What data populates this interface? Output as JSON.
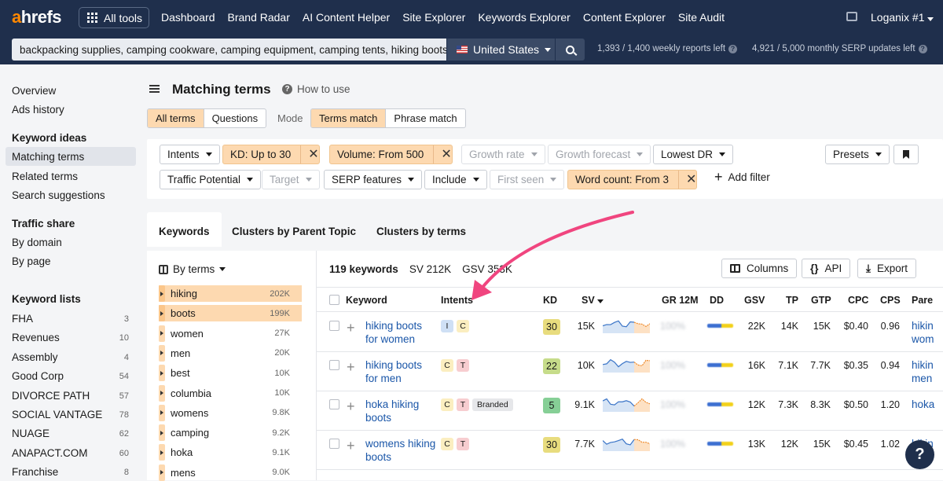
{
  "topbar": {
    "logo_a": "a",
    "logo_rest": "hrefs",
    "all_tools": "All tools",
    "nav": [
      "Dashboard",
      "Brand Radar",
      "AI Content Helper",
      "Site Explorer",
      "Keywords Explorer",
      "Content Explorer",
      "Site Audit"
    ],
    "active_nav": "Keywords Explorer",
    "user": "Loganix #1"
  },
  "searchbar": {
    "keywords": "backpacking supplies, camping cookware, camping equipment, camping tents, hiking boots, h",
    "country": "United States",
    "weekly_reports": "1,393  /  1,400  weekly reports left",
    "serp_updates": "4,921  /  5,000  monthly SERP updates left"
  },
  "sidebar": {
    "top_items": [
      "Overview",
      "Ads history"
    ],
    "keyword_ideas_head": "Keyword ideas",
    "keyword_ideas": [
      "Matching terms",
      "Related terms",
      "Search suggestions"
    ],
    "active": "Matching terms",
    "traffic_share_head": "Traffic share",
    "traffic_share": [
      "By domain",
      "By page"
    ],
    "keyword_lists_head": "Keyword lists",
    "keyword_lists": [
      {
        "name": "FHA",
        "count": "3"
      },
      {
        "name": "Revenues",
        "count": "10"
      },
      {
        "name": "Assembly",
        "count": "4"
      },
      {
        "name": "Good Corp",
        "count": "54"
      },
      {
        "name": "DIVORCE PATH",
        "count": "57"
      },
      {
        "name": "SOCIAL VANTAGE",
        "count": "78"
      },
      {
        "name": "NUAGE",
        "count": "62"
      },
      {
        "name": "ANAPACT.COM",
        "count": "60"
      },
      {
        "name": "Franchise",
        "count": "8"
      }
    ]
  },
  "page": {
    "title": "Matching terms",
    "how_to": "How to use",
    "seg1": [
      "All terms",
      "Questions"
    ],
    "mode_label": "Mode",
    "seg2": [
      "Terms match",
      "Phrase match"
    ]
  },
  "filters": {
    "intents": "Intents",
    "kd": "KD: Up to 30",
    "volume": "Volume: From 500",
    "growth_rate": "Growth rate",
    "growth_forecast": "Growth forecast",
    "lowest_dr": "Lowest DR",
    "presets": "Presets",
    "traffic_potential": "Traffic Potential",
    "target": "Target",
    "serp_features": "SERP features",
    "include": "Include",
    "first_seen": "First seen",
    "word_count": "Word count: From 3",
    "add_filter": "Add filter",
    "close_glyph": "✕"
  },
  "tabs": [
    "Keywords",
    "Clusters by Parent Topic",
    "Clusters by terms"
  ],
  "left_panel": {
    "by_terms": "By terms",
    "terms": [
      {
        "term": "hiking",
        "count": "202K",
        "selected": true
      },
      {
        "term": "boots",
        "count": "199K",
        "selected": true
      },
      {
        "term": "women",
        "count": "27K",
        "selected": false
      },
      {
        "term": "men",
        "count": "20K",
        "selected": false
      },
      {
        "term": "best",
        "count": "10K",
        "selected": false
      },
      {
        "term": "columbia",
        "count": "10K",
        "selected": false
      },
      {
        "term": "womens",
        "count": "9.8K",
        "selected": false
      },
      {
        "term": "camping",
        "count": "9.2K",
        "selected": false
      },
      {
        "term": "hoka",
        "count": "9.1K",
        "selected": false
      },
      {
        "term": "mens",
        "count": "9.0K",
        "selected": false
      }
    ]
  },
  "results": {
    "keyword_count": "119 keywords",
    "sv": "SV 212K",
    "gsv": "GSV 353K",
    "columns_btn": "Columns",
    "api_btn": "API",
    "export_btn": "Export",
    "headers": {
      "keyword": "Keyword",
      "intents": "Intents",
      "kd": "KD",
      "sv": "SV",
      "gr": "GR 12M",
      "dd": "DD",
      "gsv": "GSV",
      "tp": "TP",
      "gtp": "GTP",
      "cpc": "CPC",
      "cps": "CPS",
      "parent": "Pare"
    },
    "rows": [
      {
        "keyword": "hiking boots for women",
        "intents": [
          "I",
          "C"
        ],
        "kd": "30",
        "kd_color": "#e8dc7e",
        "sv": "15K",
        "gr": "100%",
        "gsv": "22K",
        "tp": "14K",
        "gtp": "15K",
        "cpc": "$0.40",
        "cps": "0.96",
        "parent": "hikin wom"
      },
      {
        "keyword": "hiking boots for men",
        "intents": [
          "C",
          "T"
        ],
        "kd": "22",
        "kd_color": "#c6dc8a",
        "sv": "10K",
        "gr": "100%",
        "gsv": "16K",
        "tp": "7.1K",
        "gtp": "7.7K",
        "cpc": "$0.35",
        "cps": "0.94",
        "parent": "hikin men"
      },
      {
        "keyword": "hoka hiking boots",
        "intents": [
          "C",
          "T",
          "Branded"
        ],
        "kd": "5",
        "kd_color": "#86cf96",
        "sv": "9.1K",
        "gr": "100%",
        "gsv": "12K",
        "tp": "7.3K",
        "gtp": "8.3K",
        "cpc": "$0.50",
        "cps": "1.20",
        "parent": "hoka"
      },
      {
        "keyword": "womens hiking boots",
        "intents": [
          "C",
          "T"
        ],
        "kd": "30",
        "kd_color": "#e8dc7e",
        "sv": "7.7K",
        "gr": "100%",
        "gsv": "13K",
        "tp": "12K",
        "gtp": "15K",
        "cpc": "$0.45",
        "cps": "1.02",
        "parent": "hikin"
      }
    ]
  },
  "help_glyph": "?",
  "colors": {
    "topbar": "#1f2f4c",
    "accent_orange": "#ff8800",
    "chip_on": "#fdd9b0",
    "link": "#1a56a8",
    "arrow": "#f0457f"
  }
}
